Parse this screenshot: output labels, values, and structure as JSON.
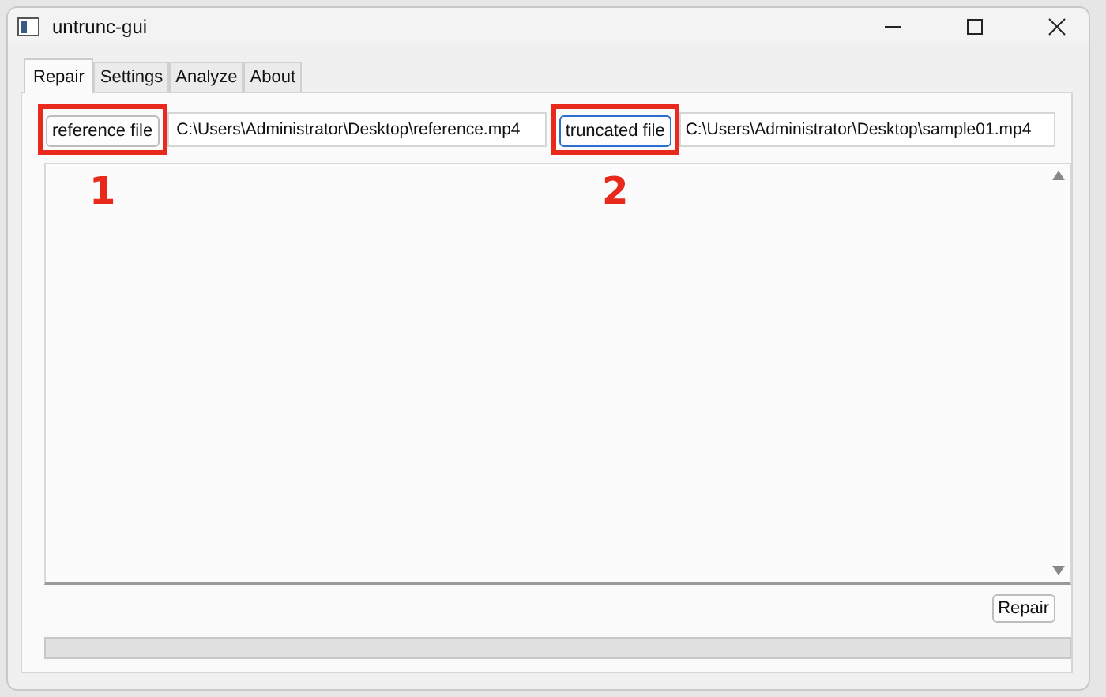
{
  "window": {
    "title": "untrunc-gui"
  },
  "tabs": [
    {
      "label": "Repair",
      "selected": true
    },
    {
      "label": "Settings",
      "selected": false
    },
    {
      "label": "Analyze",
      "selected": false
    },
    {
      "label": "About",
      "selected": false
    }
  ],
  "files": [
    {
      "button": "reference file",
      "focused": false,
      "value": "C:\\Users\\Administrator\\Desktop\\reference.mp4",
      "annotation": "1"
    },
    {
      "button": "truncated file",
      "focused": true,
      "value": "C:\\Users\\Administrator\\Desktop\\sample01.mp4",
      "annotation": "2"
    }
  ],
  "repair_button": "Repair",
  "progress": {
    "level": 0
  }
}
